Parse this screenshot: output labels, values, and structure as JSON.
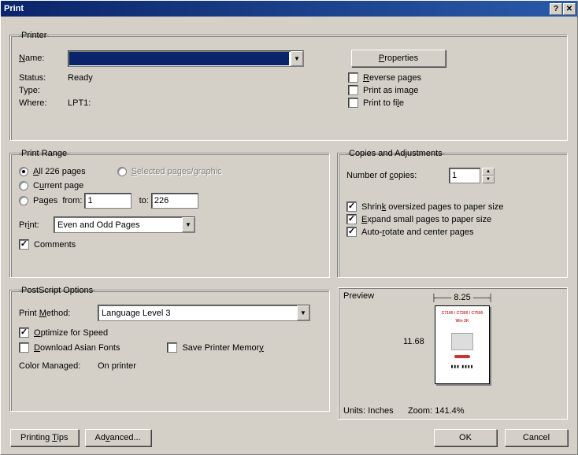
{
  "title": "Print",
  "printer": {
    "legend": "Printer",
    "name_label": "Name:",
    "name_value": "",
    "properties_btn": "Properties",
    "status_label": "Status:",
    "status_value": "Ready",
    "type_label": "Type:",
    "type_value": "",
    "where_label": "Where:",
    "where_value": "LPT1:",
    "reverse_pages": "Reverse pages",
    "print_as_image": "Print as image",
    "print_to_file": "Print to file"
  },
  "range": {
    "legend": "Print Range",
    "all_pages": "All 226 pages",
    "selected": "Selected pages/graphic",
    "current": "Current page",
    "pages_label": "Pages",
    "from_label": "from:",
    "from_value": "1",
    "to_label": "to:",
    "to_value": "226",
    "print_label": "Print:",
    "print_value": "Even and Odd Pages",
    "comments": "Comments"
  },
  "copies": {
    "legend": "Copies and Adjustments",
    "num_label": "Number of copies:",
    "num_value": "1",
    "shrink": "Shrink oversized pages to paper size",
    "expand": "Expand small pages to paper size",
    "autorotate": "Auto-rotate and center pages"
  },
  "ps": {
    "legend": "PostScript Options",
    "method_label": "Print Method:",
    "method_value": "Language Level 3",
    "optimize": "Optimize for Speed",
    "download_asian": "Download Asian Fonts",
    "save_mem": "Save Printer Memory",
    "color_label": "Color Managed:",
    "color_value": "On printer"
  },
  "preview": {
    "label": "Preview",
    "width": "8.25",
    "height": "11.68",
    "units_label": "Units:",
    "units_value": "Inches",
    "zoom_label": "Zoom:",
    "zoom_value": "141.4%"
  },
  "buttons": {
    "tips": "Printing Tips",
    "advanced": "Advanced...",
    "ok": "OK",
    "cancel": "Cancel"
  }
}
